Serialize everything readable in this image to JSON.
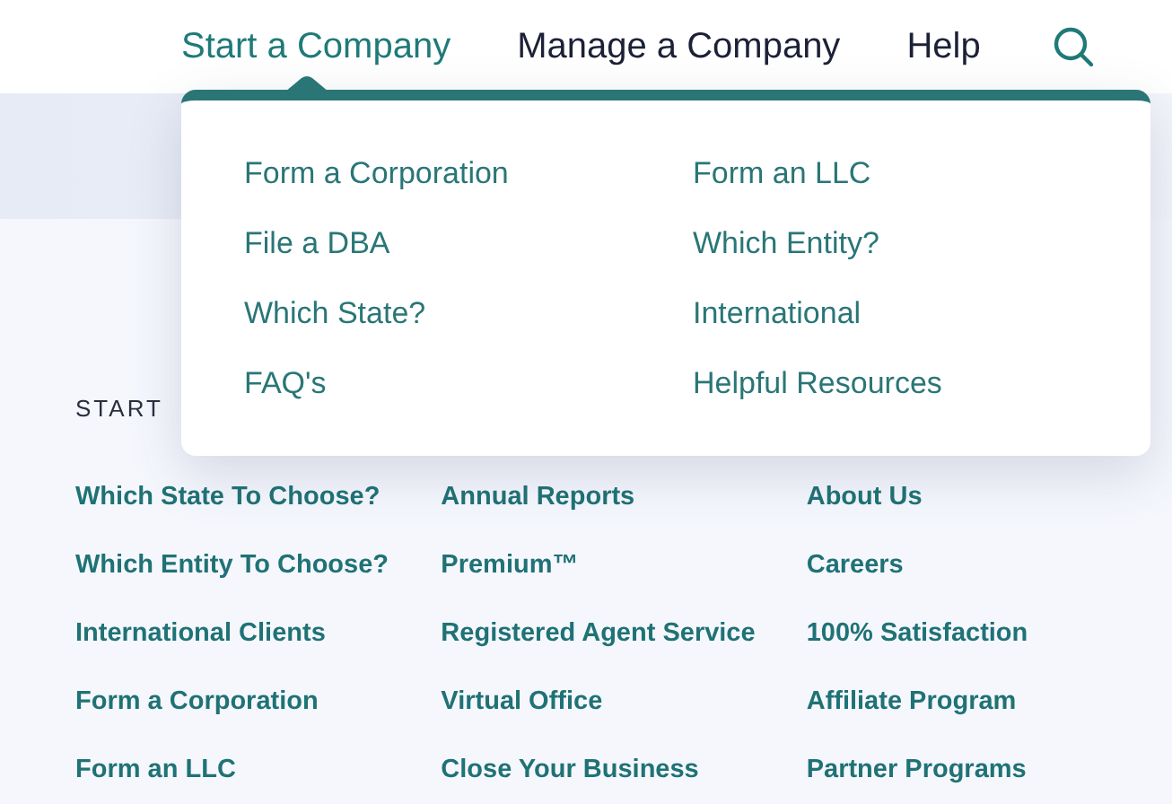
{
  "nav": {
    "items": [
      {
        "label": "Start a Company",
        "selected": true
      },
      {
        "label": "Manage a Company",
        "selected": false
      },
      {
        "label": "Help",
        "selected": false
      }
    ]
  },
  "dropdown": {
    "columns": [
      [
        "Form a Corporation",
        "File a DBA",
        "Which State?",
        "FAQ's"
      ],
      [
        "Form an LLC",
        "Which Entity?",
        "International",
        "Helpful Resources"
      ]
    ]
  },
  "footer": {
    "heading": "START",
    "columns": [
      [
        "Which State To Choose?",
        "Which Entity To Choose?",
        "International Clients",
        "Form a Corporation",
        "Form an LLC"
      ],
      [
        "Annual Reports",
        "Premium™",
        "Registered Agent Service",
        "Virtual Office",
        "Close Your Business"
      ],
      [
        "About Us",
        "Careers",
        "100% Satisfaction",
        "Affiliate Program",
        "Partner Programs"
      ]
    ]
  }
}
